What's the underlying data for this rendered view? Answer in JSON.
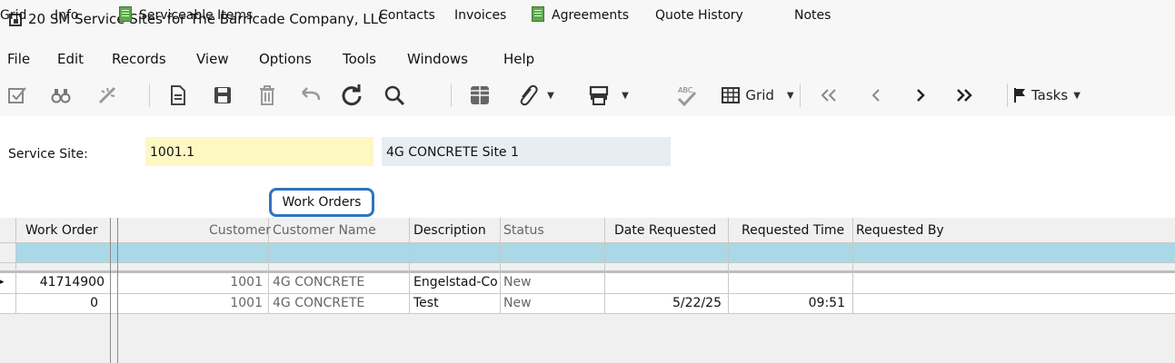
{
  "window": {
    "title": "20 SM Service Sites for The Barricade Company, LLC"
  },
  "menu": [
    "File",
    "Edit",
    "Records",
    "View",
    "Options",
    "Tools",
    "Windows",
    "Help"
  ],
  "toolbar": {
    "grid_label": "Grid",
    "tasks_label": "Tasks"
  },
  "form": {
    "service_site_label": "Service Site:",
    "service_site_value": "1001.1",
    "service_site_description": "4G CONCRETE Site 1"
  },
  "tabs": {
    "grid": "Grid",
    "info": "Info",
    "serviceable_items": "Serviceable Items",
    "work_orders": "Work Orders",
    "contacts": "Contacts",
    "invoices": "Invoices",
    "agreements": "Agreements",
    "quote_history": "Quote History",
    "notes": "Notes"
  },
  "table": {
    "columns": {
      "work_order": "Work Order",
      "customer": "Customer",
      "customer_name": "Customer Name",
      "description": "Description",
      "status": "Status",
      "date_requested": "Date Requested",
      "requested_time": "Requested Time",
      "requested_by": "Requested By"
    },
    "rows": [
      {
        "work_order": "41714900",
        "customer": "1001",
        "customer_name": "4G CONCRETE",
        "description": "Engelstad-Co",
        "status": "New",
        "date_requested": "",
        "requested_time": "",
        "requested_by": ""
      },
      {
        "work_order": "0",
        "customer": "1001",
        "customer_name": "4G CONCRETE",
        "description": "Test",
        "status": "New",
        "date_requested": "5/22/25",
        "requested_time": "09:51",
        "requested_by": ""
      }
    ]
  },
  "colors": {
    "accent_tab_border": "#2f74c0",
    "filter_row": "#a9d8e6",
    "key_field": "#fdf7c3"
  }
}
